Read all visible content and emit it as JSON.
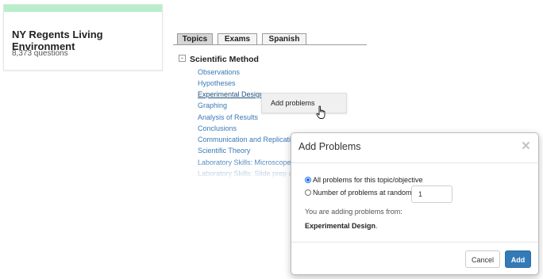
{
  "course": {
    "title": "NY Regents Living Environment",
    "count": "8,373 questions",
    "accent_color": "#b9eecb"
  },
  "tabs": [
    {
      "label": "Topics",
      "active": true
    },
    {
      "label": "Exams",
      "active": false
    },
    {
      "label": "Spanish",
      "active": false
    }
  ],
  "topic": {
    "collapse_symbol": "-",
    "title": "Scientific Method",
    "objectives": [
      "Observations",
      "Hypotheses",
      "Experimental Design",
      "Graphing",
      "Analysis of Results",
      "Conclusions",
      "Communication and Replication",
      "Scientific Theory",
      "Laboratory Skills: Microscopes",
      "Laboratory Skills: Slide prep and staining"
    ]
  },
  "context_menu": {
    "item": "Add problems"
  },
  "modal": {
    "title": "Add Problems",
    "close_symbol": "×",
    "option_all": "All problems for this topic/objective",
    "option_number": "Number of problems at random",
    "number_value": "1",
    "source_text": "You are adding problems from:",
    "source_name": "Experimental Design",
    "source_suffix": ".",
    "cancel_label": "Cancel",
    "add_label": "Add",
    "primary_color": "#337ab7"
  },
  "icons": {
    "cursor": "hand-pointer-icon"
  }
}
